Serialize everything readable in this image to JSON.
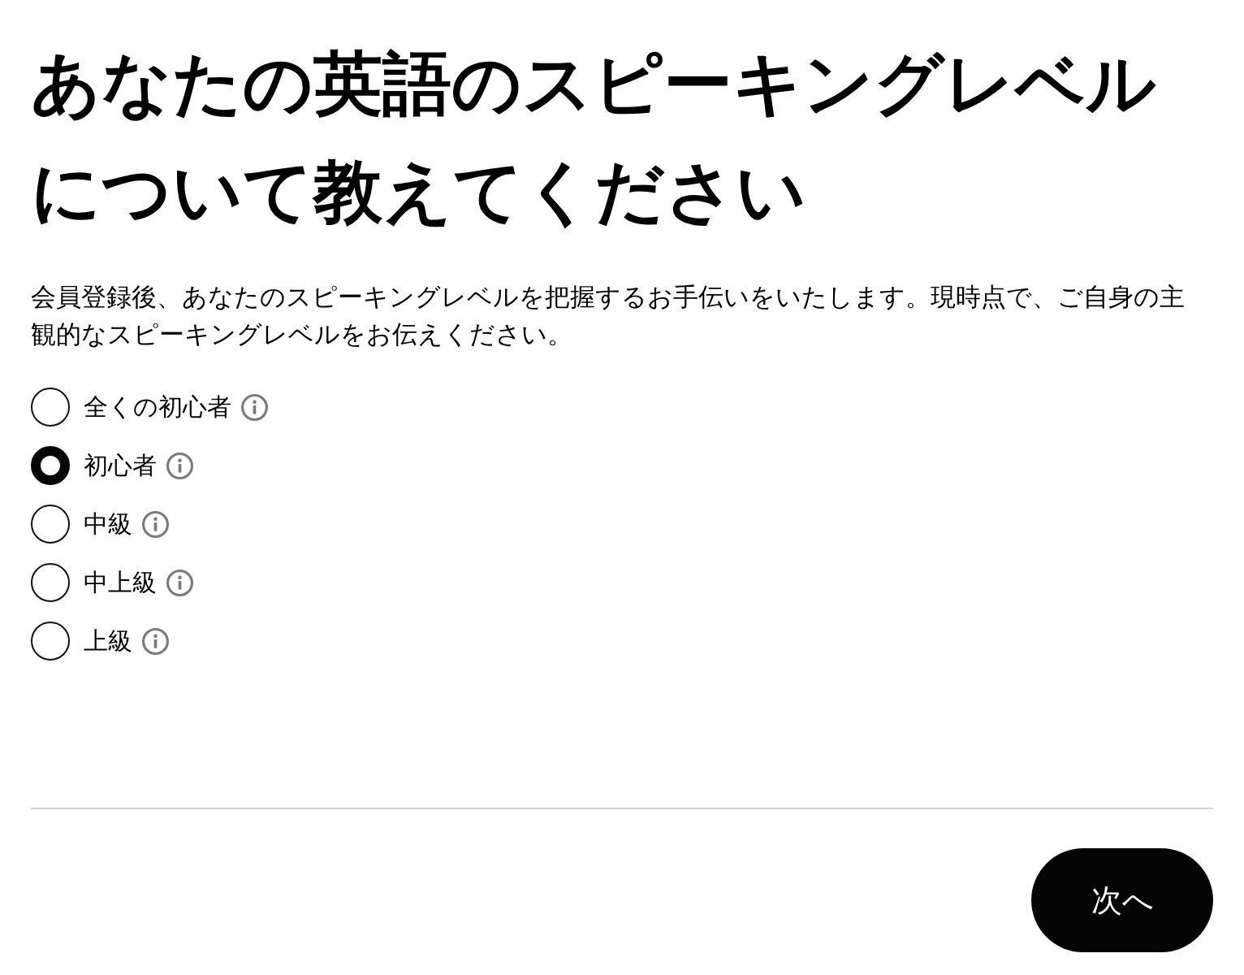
{
  "title": "あなたの英語のスピーキングレベルについて教えてください",
  "description": "会員登録後、あなたのスピーキングレベルを把握するお手伝いをいたします。現時点で、ご自身の主観的なスピーキングレベルをお伝えください。",
  "options": [
    {
      "label": "全くの初心者",
      "selected": false
    },
    {
      "label": "初心者",
      "selected": true
    },
    {
      "label": "中級",
      "selected": false
    },
    {
      "label": "中上級",
      "selected": false
    },
    {
      "label": "上級",
      "selected": false
    }
  ],
  "next_button": {
    "label": "次へ"
  }
}
